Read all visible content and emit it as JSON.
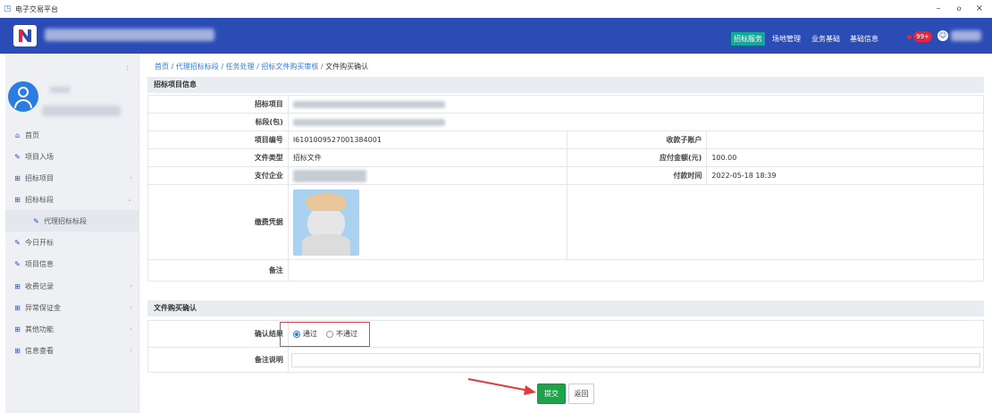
{
  "window": {
    "title": "电子交易平台",
    "min": "–",
    "restore": "ⲟ",
    "close": "×"
  },
  "header": {
    "nav": [
      {
        "label": "招标服务",
        "active": true
      },
      {
        "label": "场地管理"
      },
      {
        "label": "业务基础"
      },
      {
        "label": "基础信息"
      }
    ],
    "notification_count": "99+"
  },
  "sidebar": {
    "collapse": "⋮",
    "items": [
      {
        "label": "首页",
        "icon": "home-icon",
        "glyph": "⌂"
      },
      {
        "label": "项目入场",
        "icon": "edit-icon",
        "glyph": "✎"
      },
      {
        "label": "招标项目",
        "icon": "plus-box-icon",
        "glyph": "⊞",
        "arrow": "‹"
      },
      {
        "label": "招标标段",
        "icon": "plus-box-icon",
        "glyph": "⊞",
        "arrow": "⌄"
      },
      {
        "label": "代理招标标段",
        "icon": "edit-icon",
        "glyph": "✎",
        "sub": true
      },
      {
        "label": "今日开标",
        "icon": "edit-icon",
        "glyph": "✎"
      },
      {
        "label": "项目信息",
        "icon": "edit-icon",
        "glyph": "✎"
      },
      {
        "label": "收费记录",
        "icon": "plus-box-icon",
        "glyph": "⊞",
        "arrow": "‹"
      },
      {
        "label": "异常保证金",
        "icon": "plus-box-icon",
        "glyph": "⊞",
        "arrow": "‹"
      },
      {
        "label": "其他功能",
        "icon": "plus-box-icon",
        "glyph": "⊞",
        "arrow": "‹"
      },
      {
        "label": "信息查看",
        "icon": "plus-box-icon",
        "glyph": "⊞",
        "arrow": "‹"
      }
    ]
  },
  "breadcrumb": {
    "items": [
      "首页",
      "代理招标标段",
      "任务处理",
      "招标文件购买审核"
    ],
    "sep": " / ",
    "current": "文件购买确认"
  },
  "section1": {
    "title": "招标项目信息",
    "labels": {
      "project": "招标项目",
      "section": "标段(包)",
      "project_no": "项目编号",
      "receiver": "收款子账户",
      "file_type": "文件类型",
      "amount": "应付金额(元)",
      "payer": "支付企业",
      "pay_time": "付款时间",
      "voucher": "缴费凭据",
      "remark": "备注"
    },
    "values": {
      "project_no": "I6101009527001384001",
      "file_type": "招标文件",
      "amount": "100.00",
      "pay_time": "2022-05-18 18:39"
    }
  },
  "section2": {
    "title": "文件购买确认",
    "result_label": "确认结果",
    "pass": "通过",
    "fail": "不通过",
    "remark_label": "备注说明",
    "remark_value": ""
  },
  "buttons": {
    "submit": "提交",
    "back": "返回"
  }
}
